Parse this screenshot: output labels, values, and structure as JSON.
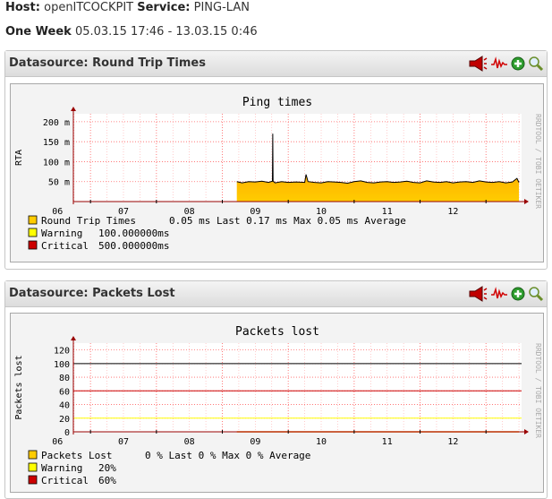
{
  "header": {
    "host_label": "Host:",
    "host_value": "openITCOCKPIT",
    "service_label": "Service:",
    "service_value": "PING-LAN",
    "range_label": "One Week",
    "range_value": "05.03.15 17:46 - 13.03.15 0:46"
  },
  "panels": [
    {
      "title": "Datasource: Round Trip Times"
    },
    {
      "title": "Datasource: Packets Lost"
    }
  ],
  "watermark": "RRDTOOL / TOBI OETIKER",
  "colors": {
    "area_top": "#ff8c00",
    "area_bottom": "#ffcc00",
    "warning": "#ffff00",
    "critical": "#cc0000",
    "axis": "#990000",
    "grid": "#ffaaaa"
  },
  "chart_data": [
    {
      "type": "area",
      "title": "Ping times",
      "ylabel": "RTA",
      "xlabel": "",
      "y_ticks": [
        "200 m",
        "150 m",
        "100 m",
        "50 m"
      ],
      "y_tick_values": [
        200,
        150,
        100,
        50
      ],
      "ylim": [
        0,
        220
      ],
      "x_ticks": [
        "06",
        "07",
        "08",
        "09",
        "10",
        "11",
        "12"
      ],
      "x_tick_values": [
        6,
        7,
        8,
        9,
        10,
        11,
        12
      ],
      "xlim": [
        5.74,
        12.54
      ],
      "grid": true,
      "legend_position": "bottom",
      "series": [
        {
          "name": "Round Trip Times",
          "unit": "ms",
          "x": [
            8.22,
            8.3,
            8.4,
            8.5,
            8.6,
            8.7,
            8.76,
            8.765,
            8.77,
            8.8,
            8.9,
            9.0,
            9.12,
            9.25,
            9.27,
            9.3,
            9.4,
            9.5,
            9.6,
            9.7,
            9.8,
            9.9,
            10.0,
            10.1,
            10.2,
            10.3,
            10.4,
            10.5,
            10.6,
            10.7,
            10.8,
            10.9,
            11.0,
            11.1,
            11.2,
            11.3,
            11.4,
            11.5,
            11.6,
            11.7,
            11.8,
            11.9,
            12.0,
            12.1,
            12.2,
            12.3,
            12.4,
            12.47,
            12.5
          ],
          "values": [
            50,
            47,
            50,
            49,
            51,
            48,
            51,
            170,
            51,
            47,
            50,
            48,
            49,
            48,
            68,
            50,
            48,
            47,
            50,
            49,
            48,
            46,
            50,
            52,
            48,
            47,
            49,
            50,
            48,
            49,
            51,
            48,
            47,
            52,
            49,
            48,
            50,
            47,
            49,
            50,
            48,
            52,
            49,
            48,
            50,
            47,
            49,
            58,
            48
          ]
        }
      ],
      "legend": [
        {
          "name": "Round Trip Times",
          "stats": "0.05 ms Last    0.17 ms Max     0.05 ms Average",
          "color": "#ffcc00"
        },
        {
          "name": "Warning",
          "stats": "100.000000ms",
          "color": "#ffff00"
        },
        {
          "name": "Critical",
          "stats": "500.000000ms",
          "color": "#cc0000"
        }
      ]
    },
    {
      "type": "line",
      "title": "Packets lost",
      "ylabel": "Packets lost",
      "xlabel": "",
      "y_ticks": [
        "120",
        "100",
        "80",
        "60",
        "40",
        "20",
        "0"
      ],
      "y_tick_values": [
        120,
        100,
        80,
        60,
        40,
        20,
        0
      ],
      "ylim": [
        0,
        130
      ],
      "x_ticks": [
        "06",
        "07",
        "08",
        "09",
        "10",
        "11",
        "12"
      ],
      "x_tick_values": [
        6,
        7,
        8,
        9,
        10,
        11,
        12
      ],
      "xlim": [
        5.74,
        12.54
      ],
      "grid": true,
      "legend_position": "bottom",
      "series": [
        {
          "name": "Packets Lost",
          "unit": "%",
          "x": [
            8.22,
            12.5
          ],
          "values": [
            0,
            0
          ]
        },
        {
          "name": "Warning",
          "value": 20
        },
        {
          "name": "Critical",
          "value": 60
        }
      ],
      "reference_lines": [
        {
          "value": 100,
          "color": "#000000"
        },
        {
          "value": 60,
          "color": "#cc0000"
        },
        {
          "value": 20,
          "color": "#ffff00"
        }
      ],
      "legend": [
        {
          "name": "Packets Lost",
          "stats": "0 % Last     0 % Max     0 % Average",
          "color": "#ffcc00"
        },
        {
          "name": "Warning",
          "stats": "20%",
          "color": "#ffff00"
        },
        {
          "name": "Critical",
          "stats": "60%",
          "color": "#cc0000"
        }
      ]
    }
  ]
}
